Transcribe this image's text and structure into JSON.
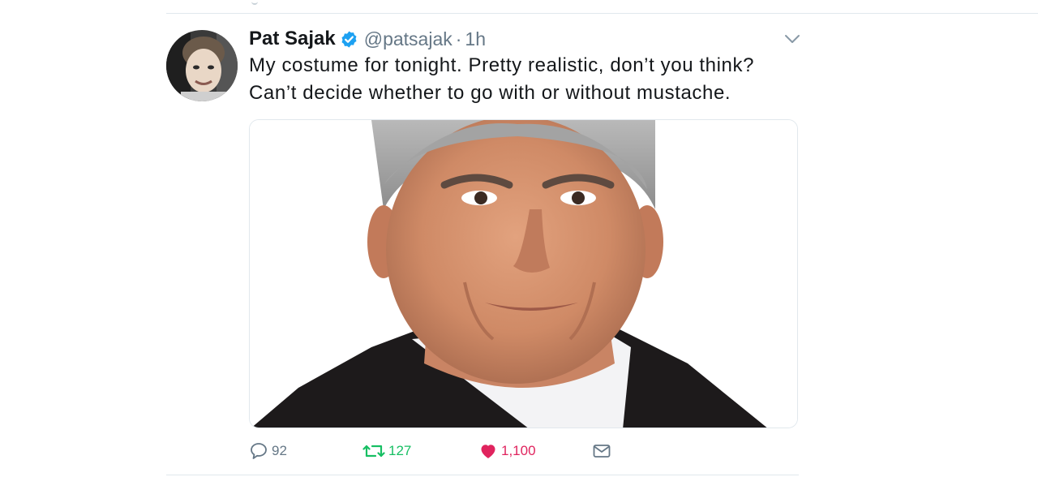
{
  "tweet": {
    "display_name": "Pat Sajak",
    "verified": true,
    "handle": "@patsajak",
    "separator": "·",
    "time": "1h",
    "text_lines": [
      "My costume for tonight. Pretty realistic, don’t you think?",
      "Can’t decide whether to go with or without mustache."
    ]
  },
  "actions": {
    "reply_count": "92",
    "retweet_count": "127",
    "like_count": "1,100"
  },
  "colors": {
    "verified_blue": "#1da1f2",
    "retweet_green": "#17bf63",
    "like_red": "#e0245e",
    "muted_gray": "#657786"
  },
  "icons": {
    "verified": "verified-badge-icon",
    "caret": "chevron-down-icon",
    "reply": "reply-bubble-icon",
    "retweet": "retweet-icon",
    "like": "heart-icon",
    "dm": "envelope-icon"
  }
}
